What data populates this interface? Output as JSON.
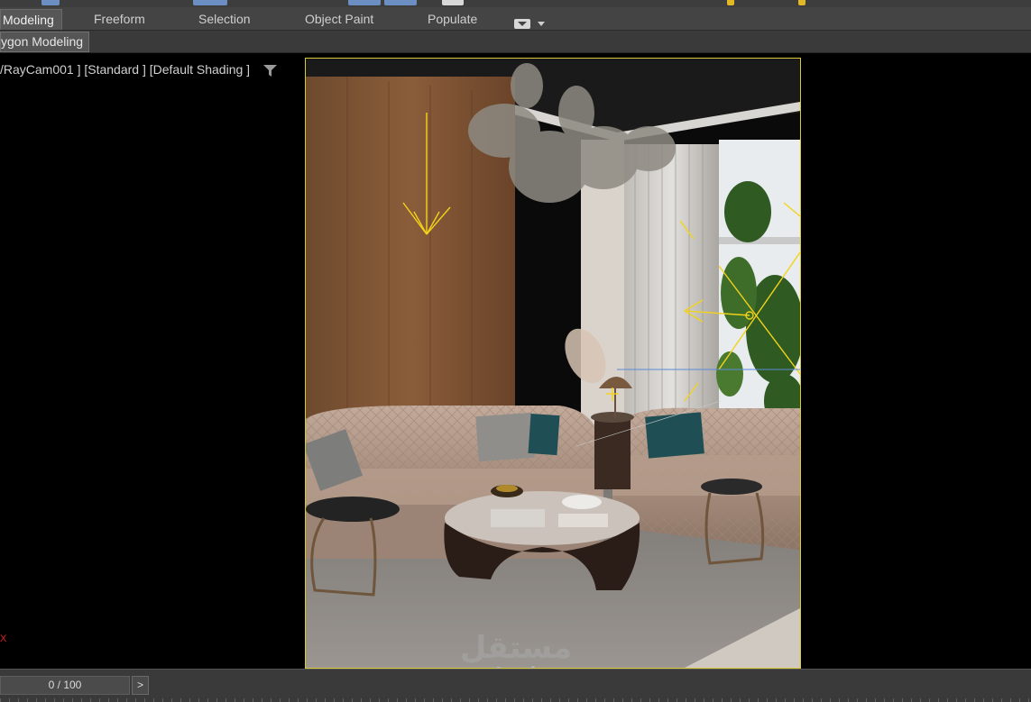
{
  "ribbon": {
    "tabs": [
      {
        "label": "Modeling",
        "active": true
      },
      {
        "label": "Freeform",
        "active": false
      },
      {
        "label": "Selection",
        "active": false
      },
      {
        "label": "Object Paint",
        "active": false
      },
      {
        "label": "Populate",
        "active": false
      }
    ],
    "panel_label": "ygon Modeling",
    "dropdown_icon": "screen-dropdown-icon"
  },
  "viewport": {
    "label": "/RayCam001 ] [Standard ] [Default Shading ]",
    "filter_icon": "filter-icon",
    "axis_label": "X",
    "frame_color": "#d9c93b"
  },
  "watermark": {
    "arabic": "مستقل",
    "latin": "mostaql.com"
  },
  "timeline": {
    "frame_text": "0 / 100",
    "next_label": ">"
  },
  "colors": {
    "accent_yellow": "#f3d21a",
    "ui_dark": "#444444",
    "viewport_bg": "#000000"
  }
}
